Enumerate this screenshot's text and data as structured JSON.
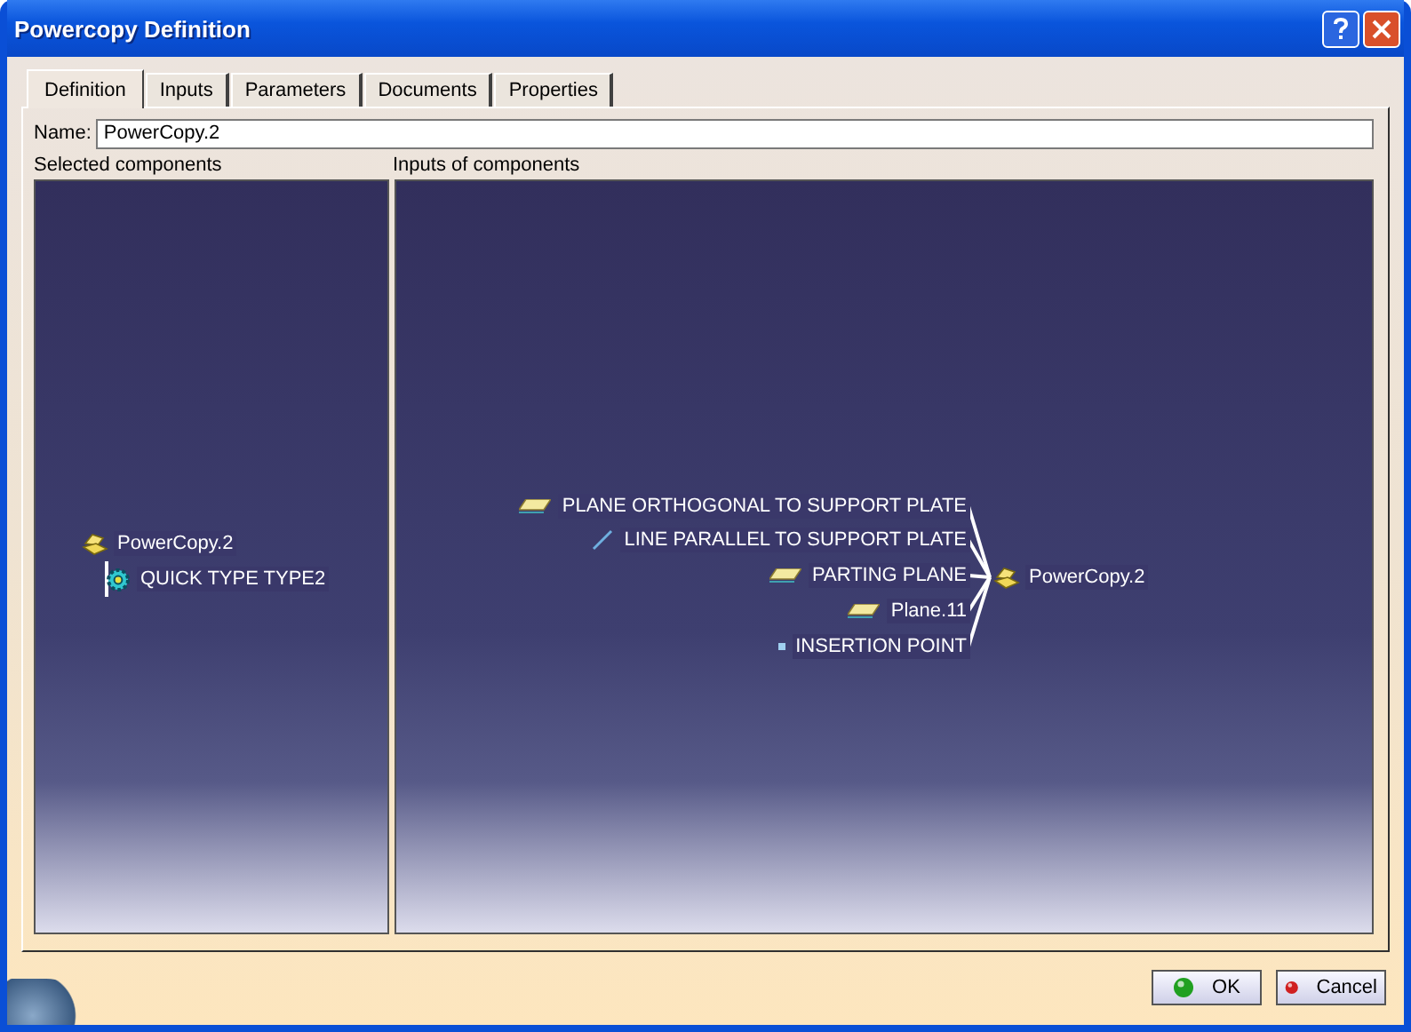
{
  "window": {
    "title": "Powercopy Definition"
  },
  "tabs": [
    {
      "label": "Definition",
      "selected": true
    },
    {
      "label": "Inputs",
      "selected": false
    },
    {
      "label": "Parameters",
      "selected": false
    },
    {
      "label": "Documents",
      "selected": false
    },
    {
      "label": "Properties",
      "selected": false
    }
  ],
  "name_field": {
    "label": "Name:",
    "value": "PowerCopy.2"
  },
  "selected_components": {
    "title": "Selected components",
    "tree": [
      {
        "label": "PowerCopy.2",
        "kind": "powercopy",
        "children": [
          {
            "label": "QUICK TYPE TYPE2",
            "kind": "feature"
          }
        ]
      }
    ]
  },
  "inputs_of_components": {
    "title": "Inputs of components",
    "inputs": [
      {
        "label": "PLANE ORTHOGONAL TO SUPPORT PLATE",
        "kind": "plane"
      },
      {
        "label": "LINE PARALLEL TO SUPPORT PLATE",
        "kind": "line"
      },
      {
        "label": "PARTING PLANE",
        "kind": "plane"
      },
      {
        "label": "Plane.11",
        "kind": "plane"
      },
      {
        "label": "INSERTION POINT",
        "kind": "point"
      }
    ],
    "target": {
      "label": "PowerCopy.2"
    }
  },
  "buttons": [
    {
      "label": "OK",
      "kind": "ok"
    },
    {
      "label": "Cancel",
      "kind": "cancel"
    }
  ]
}
